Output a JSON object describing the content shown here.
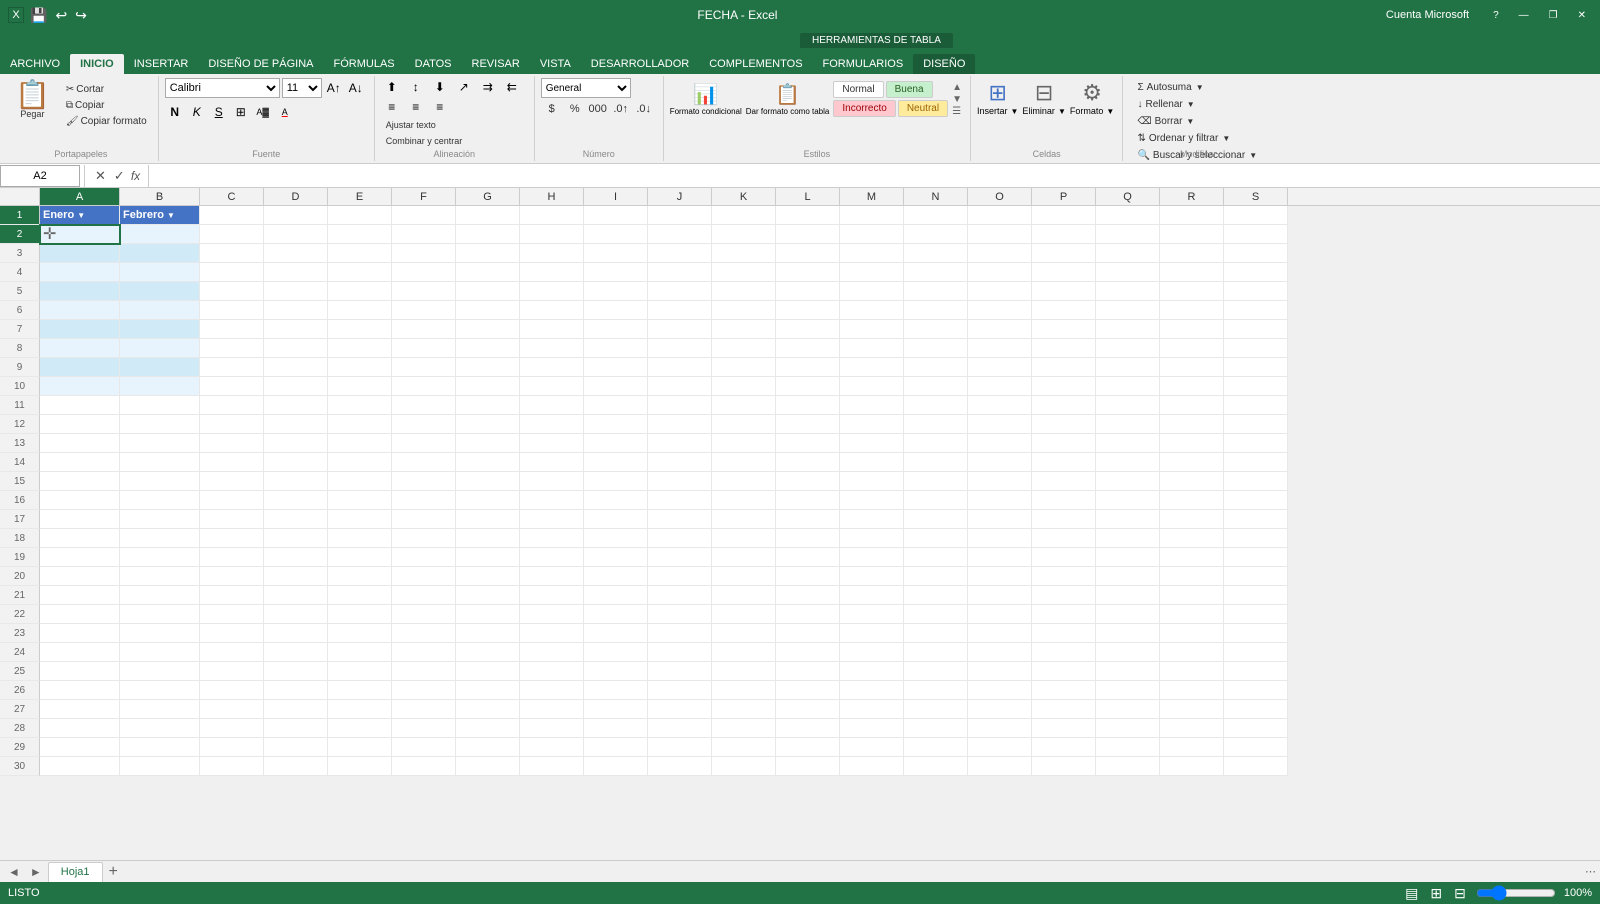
{
  "titlebar": {
    "title": "FECHA - Excel",
    "context_tab": "HERRAMIENTAS DE TABLA",
    "file_label": "ARCHIVO",
    "account": "Cuenta Microsoft",
    "win_minimize": "—",
    "win_restore": "❐",
    "win_close": "✕",
    "help": "?"
  },
  "ribbon": {
    "tabs": [
      "ARCHIVO",
      "INICIO",
      "INSERTAR",
      "DISEÑO DE PÁGINA",
      "FÓRMULAS",
      "DATOS",
      "REVISAR",
      "VISTA",
      "DESARROLLADOR",
      "COMPLEMENTOS",
      "FORMULARIOS",
      "DISEÑO"
    ],
    "active_tab": "INICIO",
    "groups": {
      "portapapeles": {
        "label": "Portapapeles",
        "pegar": "Pegar",
        "cortar": "Cortar",
        "copiar": "Copiar",
        "copiar_formato": "Copiar formato"
      },
      "fuente": {
        "label": "Fuente",
        "font_name": "Calibri",
        "font_size": "11",
        "bold": "N",
        "italic": "K",
        "underline": "S"
      },
      "alineacion": {
        "label": "Alineación",
        "ajustar_texto": "Ajustar texto",
        "combinar": "Combinar y centrar"
      },
      "numero": {
        "label": "Número",
        "format": "General"
      },
      "estilos": {
        "label": "Estilos",
        "normal": "Normal",
        "buena": "Buena",
        "incorrecto": "Incorrecto",
        "neutral": "Neutral",
        "formato_condicional": "Formato condicional",
        "dar_formato": "Dar formato como tabla"
      },
      "celdas": {
        "label": "Celdas",
        "insertar": "Insertar",
        "eliminar": "Eliminar",
        "formato": "Formato"
      },
      "modificar": {
        "label": "Modificar",
        "autosuma": "Autosuma",
        "rellenar": "Rellenar",
        "borrar": "Borrar",
        "ordenar": "Ordenar y filtrar",
        "buscar": "Buscar y seleccionar"
      }
    }
  },
  "formula_bar": {
    "name_box": "A2",
    "fx_label": "fx"
  },
  "spreadsheet": {
    "columns": [
      "A",
      "B",
      "C",
      "D",
      "E",
      "F",
      "G",
      "H",
      "I",
      "J",
      "K",
      "L",
      "M",
      "N",
      "O",
      "P",
      "Q",
      "R",
      "S"
    ],
    "active_cell": "A2",
    "rows": 30,
    "table": {
      "col_a_header": "Enero",
      "col_b_header": "Febrero",
      "table_rows": 10
    }
  },
  "sheet_tabs": {
    "tabs": [
      "Hoja1"
    ],
    "active": "Hoja1",
    "add_label": "+"
  },
  "status_bar": {
    "status": "LISTO",
    "zoom": "100%"
  }
}
